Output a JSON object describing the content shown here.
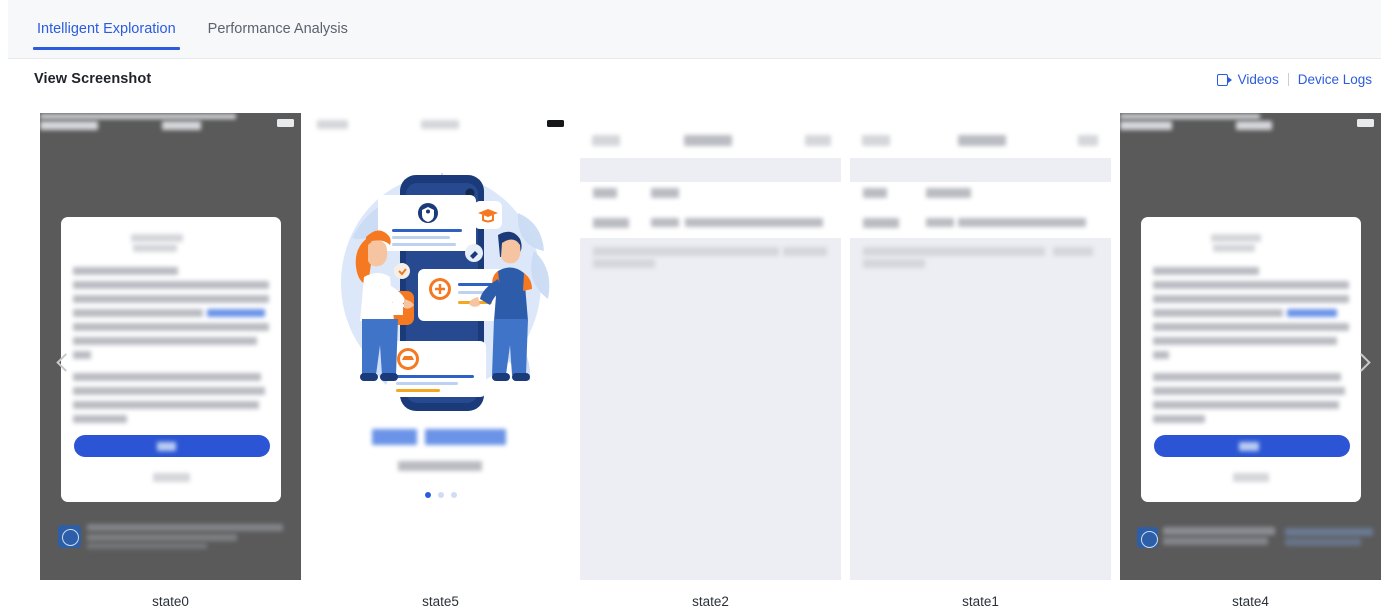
{
  "tabs": [
    {
      "label": "Intelligent Exploration",
      "active": true
    },
    {
      "label": "Performance Analysis",
      "active": false
    }
  ],
  "section": {
    "title": "View Screenshot",
    "actions": [
      {
        "label": "Videos",
        "icon": "video-camera-icon"
      },
      {
        "label": "Device Logs",
        "icon": "none"
      }
    ]
  },
  "carousel": {
    "prev_icon": "chevron-left-icon",
    "next_icon": "chevron-right-icon",
    "cards": [
      {
        "label": "state0",
        "kind": "dialog-overlay"
      },
      {
        "label": "state5",
        "kind": "illustration"
      },
      {
        "label": "state2",
        "kind": "list"
      },
      {
        "label": "state1",
        "kind": "list"
      },
      {
        "label": "state4",
        "kind": "dialog-overlay"
      }
    ]
  },
  "colors": {
    "accent": "#2b5ce0",
    "tabbar_bg": "#f7f8fa",
    "overlay": "#5a5a5a",
    "list_bg": "#eceef3",
    "text": "#1f2329",
    "muted": "#5c6270"
  }
}
